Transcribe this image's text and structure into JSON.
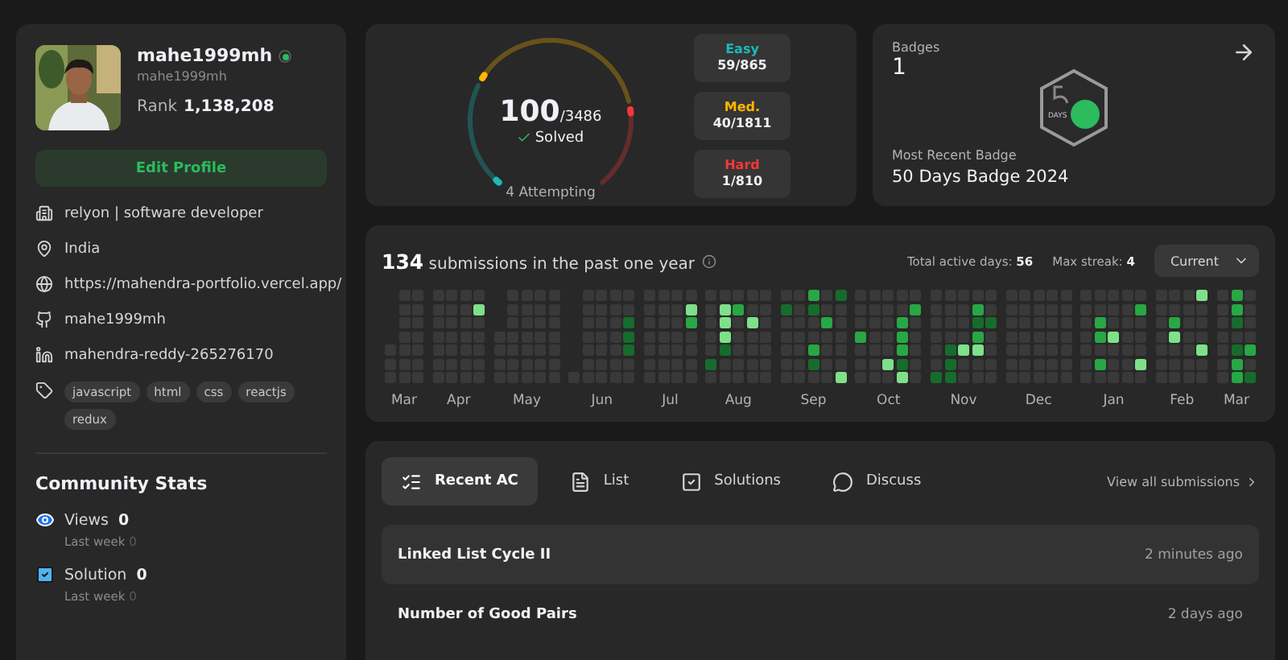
{
  "profile": {
    "display_name": "mahe1999mh",
    "username": "mahe1999mh",
    "rank_label": "Rank",
    "rank": "1,138,208",
    "edit_button": "Edit Profile",
    "info": [
      {
        "kind": "work",
        "text": "relyon | software developer"
      },
      {
        "kind": "location",
        "text": "India"
      },
      {
        "kind": "website",
        "text": "https://mahendra-portfolio.vercel.app/"
      },
      {
        "kind": "github",
        "text": "mahe1999mh"
      },
      {
        "kind": "linkedin",
        "text": "mahendra-reddy-265276170"
      }
    ],
    "skills": [
      "javascript",
      "html",
      "css",
      "reactjs",
      "redux"
    ]
  },
  "community_stats": {
    "title": "Community Stats",
    "items": [
      {
        "kind": "views",
        "label": "Views",
        "value": "0",
        "sub_label": "Last week",
        "sub_value": "0"
      },
      {
        "kind": "solution",
        "label": "Solution",
        "value": "0",
        "sub_label": "Last week",
        "sub_value": "0"
      }
    ]
  },
  "solved": {
    "count": "100",
    "total": "/3486",
    "label": "Solved",
    "attempting": "4 Attempting",
    "difficulties": [
      {
        "label": "Easy",
        "value": "59/865",
        "color": "#1cbaba"
      },
      {
        "label": "Med.",
        "value": "40/1811",
        "color": "#ffb700"
      },
      {
        "label": "Hard",
        "value": "1/810",
        "color": "#f63737"
      }
    ]
  },
  "badges": {
    "title": "Badges",
    "count": "1",
    "badge_text": "DAYS",
    "recent_label": "Most Recent Badge",
    "recent_name": "50 Days Badge 2024"
  },
  "calendar": {
    "count": "134",
    "text": "submissions in the past one year",
    "active_label": "Total active days:",
    "active_value": "56",
    "streak_label": "Max streak:",
    "streak_value": "4",
    "dropdown": "Current",
    "months": [
      {
        "label": "Mar"
      },
      {
        "label": "Apr"
      },
      {
        "label": "May"
      },
      {
        "label": "Jun"
      },
      {
        "label": "Jul"
      },
      {
        "label": "Aug"
      },
      {
        "label": "Sep"
      },
      {
        "label": "Oct"
      },
      {
        "label": "Nov"
      },
      {
        "label": "Dec"
      },
      {
        "label": "Jan"
      },
      {
        "label": "Feb"
      },
      {
        "label": "Mar"
      }
    ]
  },
  "activity": {
    "tabs": [
      {
        "kind": "recent",
        "label": "Recent AC",
        "selected": true
      },
      {
        "kind": "list",
        "label": "List",
        "selected": false
      },
      {
        "kind": "solutions",
        "label": "Solutions",
        "selected": false
      },
      {
        "kind": "discuss",
        "label": "Discuss",
        "selected": false
      }
    ],
    "view_all": "View all submissions",
    "rows": [
      {
        "title": "Linked List Cycle II",
        "time": "2 minutes ago"
      },
      {
        "title": "Number of Good Pairs",
        "time": "2 days ago"
      }
    ]
  }
}
